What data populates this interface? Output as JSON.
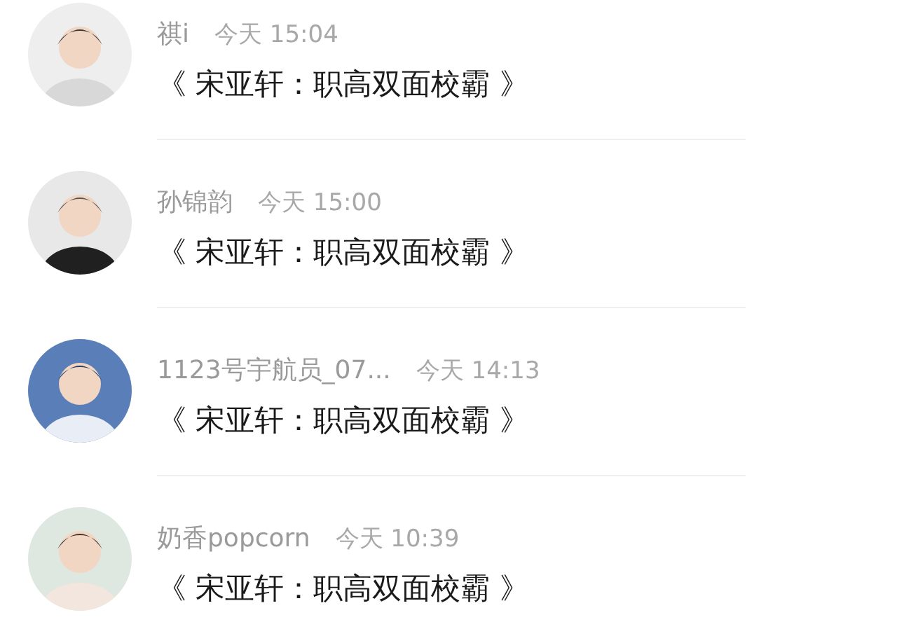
{
  "messages": [
    {
      "name": "祺i",
      "time": "今天 15:04",
      "text": "《 宋亚轩：职高双面校霸 》"
    },
    {
      "name": "孙锦韵",
      "time": "今天 15:00",
      "text": "《 宋亚轩：职高双面校霸 》"
    },
    {
      "name": "1123号宇航员_07...",
      "time": "今天 14:13",
      "text": "《 宋亚轩：职高双面校霸 》"
    },
    {
      "name": "奶香popcorn",
      "time": "今天 10:39",
      "text": "《 宋亚轩：职高双面校霸 》"
    }
  ]
}
